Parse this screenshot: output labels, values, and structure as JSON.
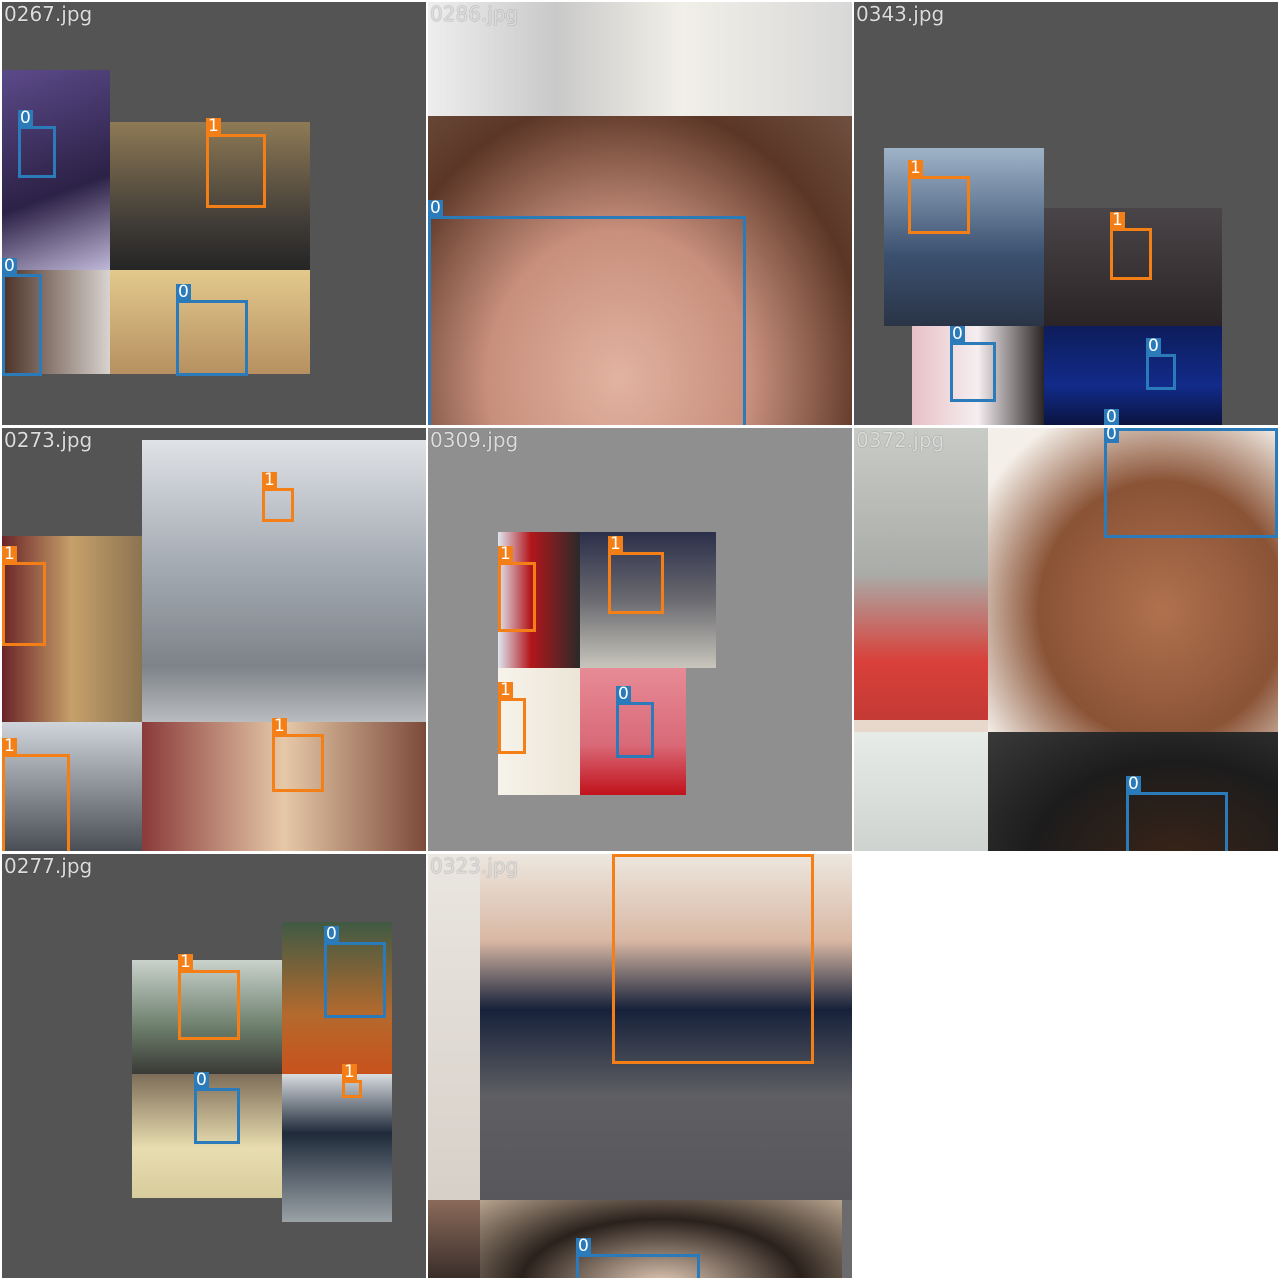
{
  "tiles": [
    {
      "name": "0267.jpg",
      "bg": "#545454"
    },
    {
      "name": "0286.jpg",
      "bg": "#6a4a3c"
    },
    {
      "name": "0343.jpg",
      "bg": "#545454"
    },
    {
      "name": "0273.jpg",
      "bg": "#545454"
    },
    {
      "name": "0309.jpg",
      "bg": "#8f8f8f"
    },
    {
      "name": "0372.jpg",
      "bg": "#e8d8cc"
    },
    {
      "name": "0277.jpg",
      "bg": "#545454"
    },
    {
      "name": "0323.jpg",
      "bg": "#6b6b6e"
    }
  ],
  "classes": {
    "0": {
      "label": "0",
      "color": "#2b7bba"
    },
    "1": {
      "label": "1",
      "color": "#f57f17"
    }
  }
}
